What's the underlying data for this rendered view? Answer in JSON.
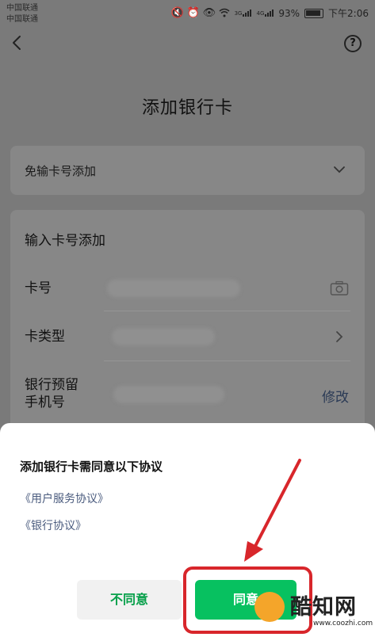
{
  "status_bar": {
    "carrier1": "中国联通",
    "carrier2": "中国联通",
    "net1": "3G",
    "net2": "4G",
    "battery": "93%",
    "time": "下午2:06"
  },
  "page": {
    "title": "添加银行卡"
  },
  "quick_add": {
    "label": "免输卡号添加"
  },
  "manual_add": {
    "title": "输入卡号添加",
    "card_no_label": "卡号",
    "card_type_label": "卡类型",
    "phone_label_line1": "银行预留",
    "phone_label_line2": "手机号",
    "modify_label": "修改"
  },
  "agreement_sheet": {
    "title": "添加银行卡需同意以下协议",
    "links": [
      "《用户服务协议》",
      "《银行协议》"
    ],
    "disagree_label": "不同意",
    "agree_label": "同意"
  },
  "watermark": {
    "name": "酷知网",
    "url": "www.coozhi.com"
  },
  "colors": {
    "primary_green": "#07c160",
    "annotation_red": "#d8262b",
    "link_blue": "#4a5b7e"
  }
}
